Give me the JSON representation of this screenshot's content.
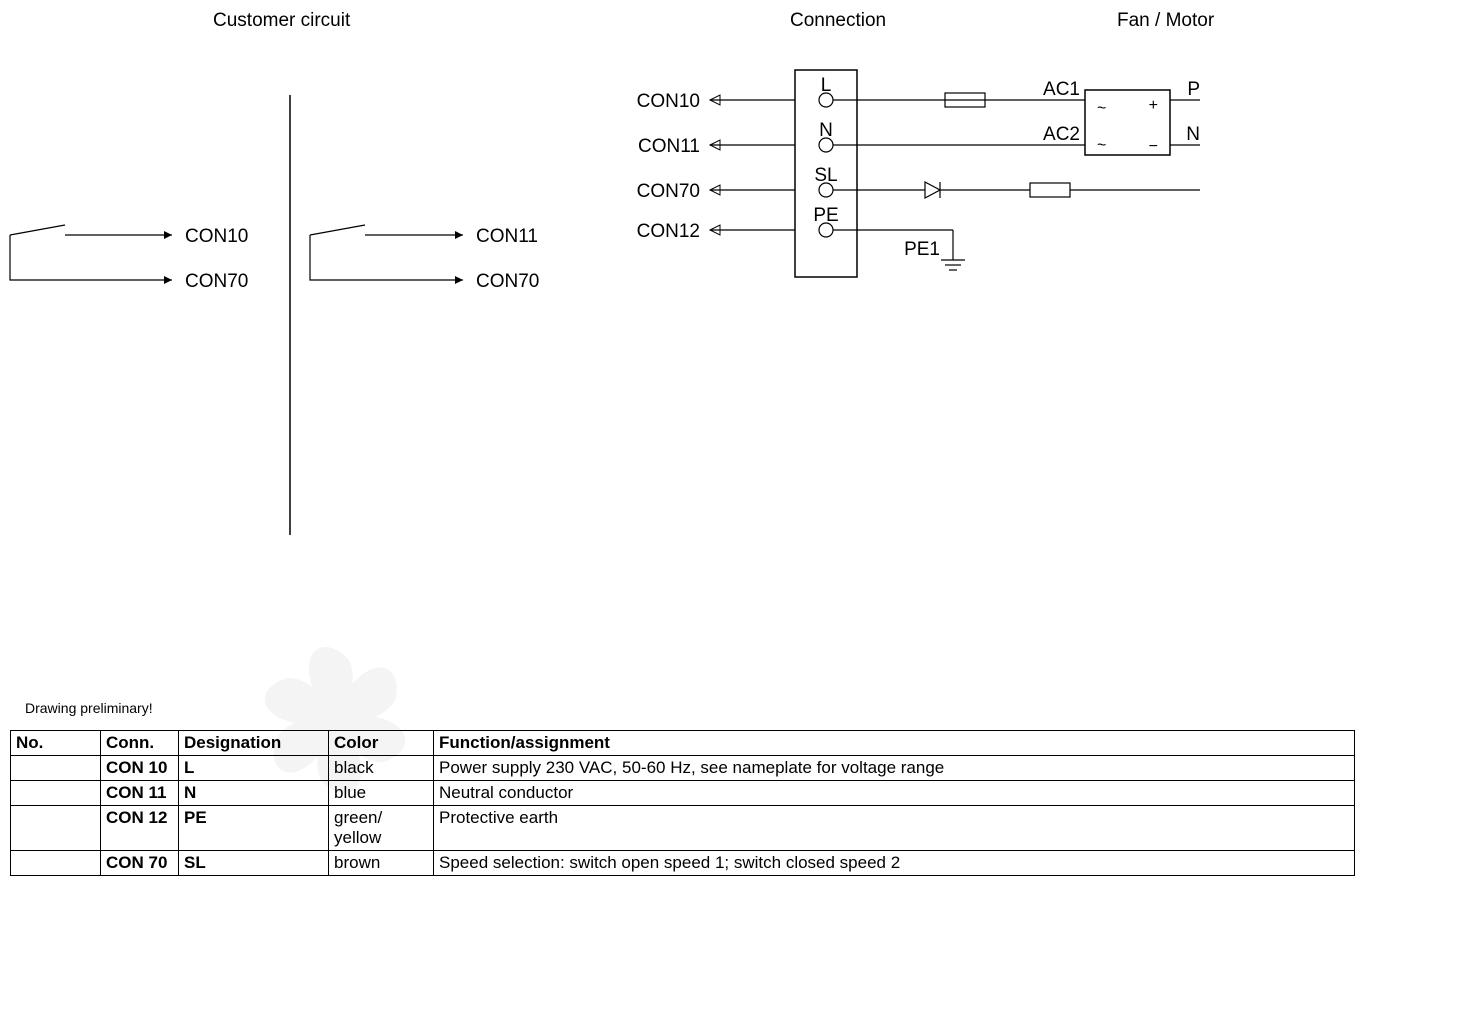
{
  "headings": {
    "customer_circuit": "Customer circuit",
    "connection": "Connection",
    "fan_motor": "Fan / Motor"
  },
  "preliminary": "Drawing preliminary!",
  "diagram": {
    "cust_left_top": "CON10",
    "cust_left_bottom": "CON70",
    "cust_right_top": "CON11",
    "cust_right_bottom": "CON70",
    "conn_1": "CON10",
    "conn_2": "CON11",
    "conn_3": "CON70",
    "conn_4": "CON12",
    "term_1": "L",
    "term_2": "N",
    "term_3": "SL",
    "term_4": "PE",
    "ac1": "AC1",
    "ac2": "AC2",
    "pe1": "PE1",
    "p": "P",
    "n": "N",
    "tilde1": "~",
    "tilde2": "~",
    "plus": "+",
    "minus": "−"
  },
  "table": {
    "headers": {
      "no": "No.",
      "conn": "Conn.",
      "desig": "Designation",
      "color": "Color",
      "func": "Function/assignment"
    },
    "rows": [
      {
        "no": "",
        "conn": "CON 10",
        "desig": "L",
        "color": "black",
        "func": "Power supply 230 VAC, 50-60 Hz, see nameplate for voltage range"
      },
      {
        "no": "",
        "conn": "CON 11",
        "desig": "N",
        "color": "blue",
        "func": "Neutral conductor"
      },
      {
        "no": "",
        "conn": "CON 12",
        "desig": "PE",
        "color": "green/ yellow",
        "func": "Protective earth"
      },
      {
        "no": "",
        "conn": "CON 70",
        "desig": "SL",
        "color": "brown",
        "func": "Speed selection: switch open speed 1; switch closed speed 2"
      }
    ]
  }
}
